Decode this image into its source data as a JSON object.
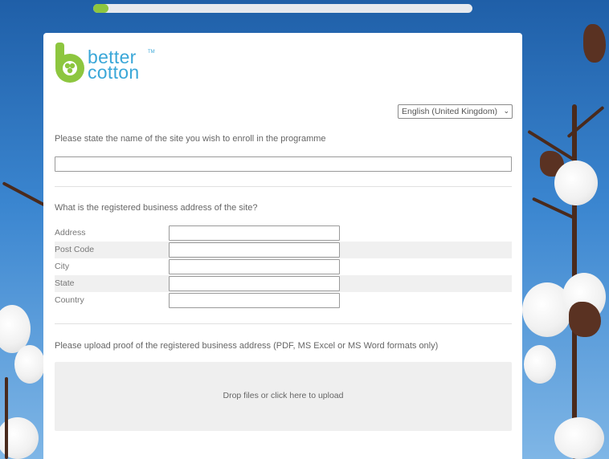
{
  "progress": {
    "fraction": 0.04
  },
  "brand": {
    "line1": "better",
    "line2": "cotton",
    "tm": "TM",
    "green": "#8dc63f",
    "blue": "#3aa7d8"
  },
  "language": {
    "selected": "English (United Kingdom)",
    "icon": "chevron-down-icon"
  },
  "site_name": {
    "question": "Please state the name of the site you wish to enroll in the programme",
    "value": ""
  },
  "address": {
    "question": "What is the registered business address of the site?",
    "fields": [
      {
        "label": "Address",
        "value": ""
      },
      {
        "label": "Post Code",
        "value": ""
      },
      {
        "label": "City",
        "value": ""
      },
      {
        "label": "State",
        "value": ""
      },
      {
        "label": "Country",
        "value": ""
      }
    ]
  },
  "upload": {
    "question": "Please upload proof of the registered business address (PDF, MS Excel or MS Word formats only)",
    "dropzone_label": "Drop files or click here to upload"
  }
}
